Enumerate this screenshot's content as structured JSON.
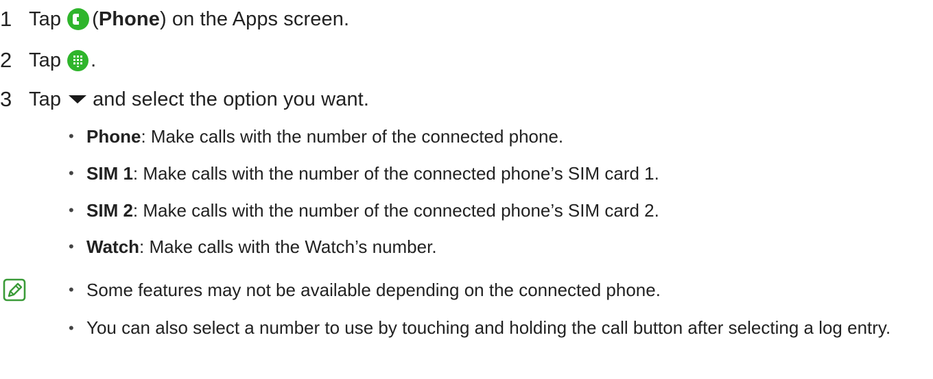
{
  "steps": [
    {
      "num": "1",
      "pre": "Tap",
      "bold": "Phone",
      "post": ") on the Apps screen.",
      "open_paren": "(",
      "icon": "phone-app-icon"
    },
    {
      "num": "2",
      "pre": "Tap",
      "post": ".",
      "icon": "keypad-icon"
    },
    {
      "num": "3",
      "pre": "Tap",
      "post": "and select the option you want.",
      "icon": "dropdown-triangle-icon"
    }
  ],
  "options": [
    {
      "label": "Phone",
      "desc": ": Make calls with the number of the connected phone."
    },
    {
      "label": "SIM 1",
      "desc": ": Make calls with the number of the connected phone’s SIM card 1."
    },
    {
      "label": "SIM 2",
      "desc": ": Make calls with the number of the connected phone’s SIM card 2."
    },
    {
      "label": "Watch",
      "desc": ": Make calls with the Watch’s number."
    }
  ],
  "notes": [
    "Some features may not be available depending on the connected phone.",
    "You can also select a number to use by touching and holding the call button after selecting a log entry."
  ],
  "bullet_char": "•",
  "colors": {
    "text": "#222222",
    "icon_green": "#2fb52c",
    "note_icon_green": "#3a9b38"
  }
}
